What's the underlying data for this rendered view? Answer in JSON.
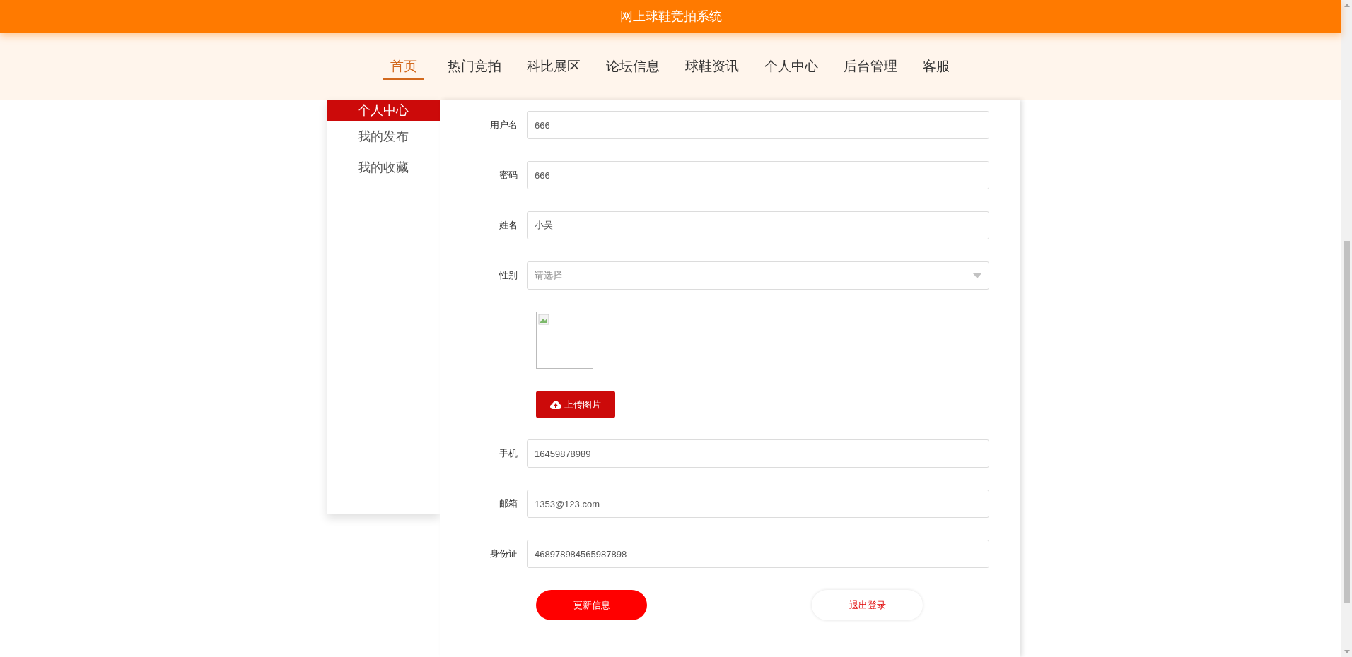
{
  "header": {
    "title": "网上球鞋竞拍系统"
  },
  "nav": [
    {
      "label": "首页",
      "selected": true
    },
    {
      "label": "热门竞拍",
      "selected": false
    },
    {
      "label": "科比展区",
      "selected": false
    },
    {
      "label": "论坛信息",
      "selected": false
    },
    {
      "label": "球鞋资讯",
      "selected": false
    },
    {
      "label": "个人中心",
      "selected": false
    },
    {
      "label": "后台管理",
      "selected": false
    },
    {
      "label": "客服",
      "selected": false
    }
  ],
  "sidebar": [
    {
      "label": "个人中心",
      "selected": true
    },
    {
      "label": "我的发布",
      "selected": false
    },
    {
      "label": "我的收藏",
      "selected": false
    }
  ],
  "form": {
    "fields": [
      {
        "kind": "text",
        "label": "用户名",
        "value": "666"
      },
      {
        "kind": "text",
        "label": "密码",
        "value": "666"
      },
      {
        "kind": "text",
        "label": "姓名",
        "value": "小吴"
      },
      {
        "kind": "select",
        "label": "性别",
        "placeholder": "请选择"
      },
      {
        "kind": "image",
        "button": "上传图片"
      },
      {
        "kind": "text",
        "label": "手机",
        "value": "16459878989"
      },
      {
        "kind": "text",
        "label": "邮箱",
        "value": "1353@123.com"
      },
      {
        "kind": "text",
        "label": "身份证",
        "value": "468978984565987898"
      }
    ],
    "buttons": [
      {
        "kind": "primary",
        "label": "更新信息"
      },
      {
        "kind": "secondary",
        "label": "退出登录"
      }
    ]
  }
}
